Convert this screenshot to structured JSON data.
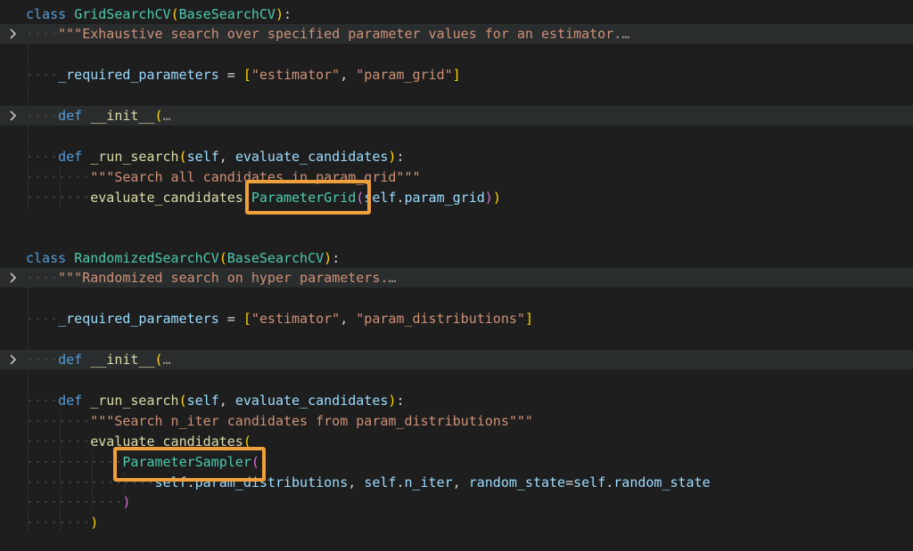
{
  "editor": {
    "colors": {
      "background": "#1e1e1e",
      "folded_line": "#2a2d2e",
      "keyword": "#569cd6",
      "class_name": "#4ec9b0",
      "function": "#dcdcaa",
      "string": "#ce9178",
      "variable": "#9cdcfe",
      "highlight_box": "#f0a03a"
    },
    "fold_icon": "chevron-right-icon",
    "class1": {
      "kw": "class",
      "name": "GridSearchCV",
      "base": "BaseSearchCV",
      "doc": "\"\"\"Exhaustive search over specified parameter values for an estimator.",
      "req_var": "_required_parameters",
      "req_s1": "\"estimator\"",
      "req_s2": "\"param_grid\"",
      "init_kw": "def",
      "init_name": "__init__",
      "run_kw": "def",
      "run_name": "_run_search",
      "arg_self": "self",
      "arg_eval": "evaluate_candidates",
      "run_doc": "\"\"\"Search all candidates in param_grid\"\"\"",
      "call_fn": "evaluate_candidates",
      "call_cls": "ParameterGrid",
      "call_self": "self",
      "call_attr": "param_grid"
    },
    "class2": {
      "kw": "class",
      "name": "RandomizedSearchCV",
      "base": "BaseSearchCV",
      "doc": "\"\"\"Randomized search on hyper parameters.",
      "req_var": "_required_parameters",
      "req_s1": "\"estimator\"",
      "req_s2": "\"param_distributions\"",
      "init_kw": "def",
      "init_name": "__init__",
      "run_kw": "def",
      "run_name": "_run_search",
      "arg_self": "self",
      "arg_eval": "evaluate_candidates",
      "run_doc": "\"\"\"Search n_iter candidates from param_distributions\"\"\"",
      "call_fn": "evaluate_candidates",
      "call_cls": "ParameterSampler",
      "args_self1": "self",
      "args_attr1": "param_distributions",
      "args_self2": "self",
      "args_attr2": "n_iter",
      "args_kw": "random_state",
      "args_self3": "self",
      "args_attr3": "random_state"
    }
  }
}
